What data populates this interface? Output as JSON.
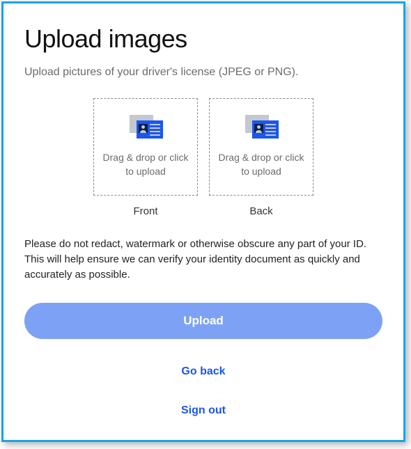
{
  "title": "Upload images",
  "subtitle": "Upload pictures of your driver's license (JPEG or PNG).",
  "dropzones": {
    "front": {
      "hint": "Drag & drop or click to upload",
      "label": "Front"
    },
    "back": {
      "hint": "Drag & drop or click to upload",
      "label": "Back"
    }
  },
  "helper_text": "Please do not redact, watermark or otherwise obscure any part of your ID. This will help ensure we can verify your identity document as quickly and accurately as possible.",
  "buttons": {
    "upload": "Upload",
    "go_back": "Go back",
    "sign_out": "Sign out"
  }
}
